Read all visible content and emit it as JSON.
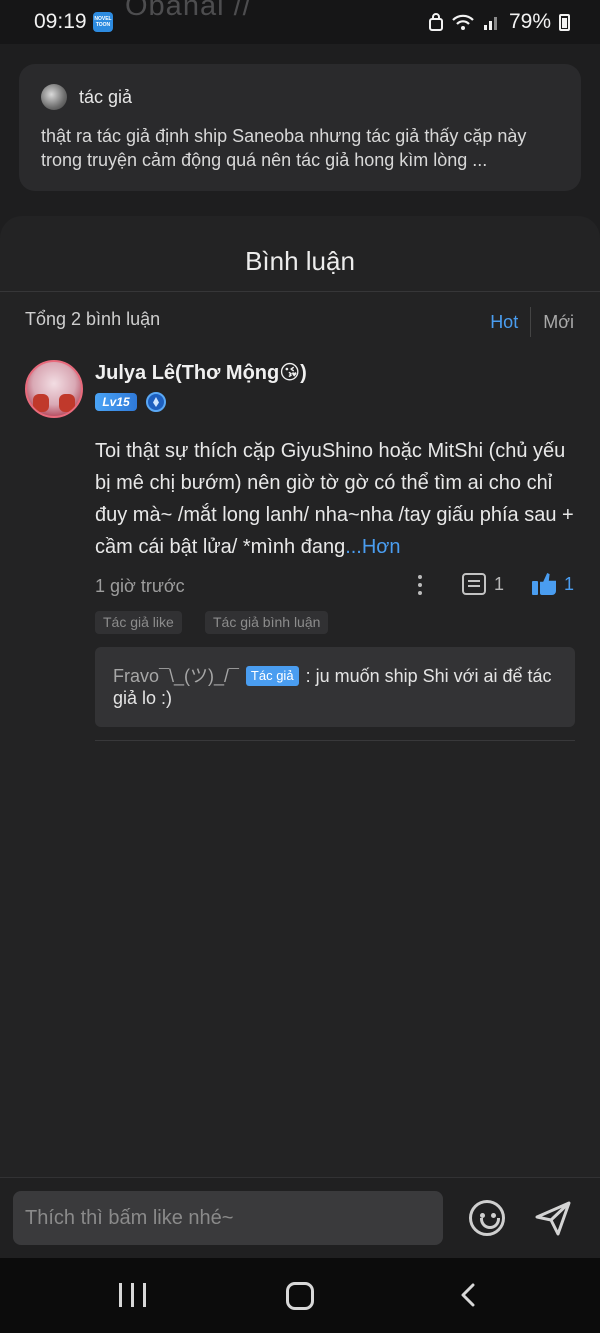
{
  "status_bar": {
    "time": "09:19",
    "app_badge": "NOVEL TOON",
    "background_title": "Obanai //",
    "battery": "79%"
  },
  "author_note": {
    "name": "tác giả",
    "text": "thật ra tác giả định ship Saneoba nhưng tác giả thấy cặp này trong truyện cảm động quá nên tác giả hong kìm lòng ..."
  },
  "comments_sheet": {
    "title": "Bình luận",
    "count_label": "Tổng 2 bình luận",
    "sort_hot": "Hot",
    "sort_new": "Mới"
  },
  "comment": {
    "user_name": "Julya Lê(Thơ Mộng😘)",
    "level": "Lv15",
    "body": "Toi thật sự thích cặp GiyuShino hoặc MitShi (chủ yếu bị mê chị bướm) nên giờ tờ gờ có thể tìm ai cho chỉ đuy mà~ /mắt long lanh/ nha~nha /tay giấu phía sau + cầm cái bật lửa/ *mình đang",
    "more": "...Hơn",
    "time": "1 giờ trước",
    "reply_count": "1",
    "like_count": "1",
    "tags": [
      "Tác giả like",
      "Tác giả bình luận"
    ],
    "reply": {
      "user": "Fravo¯\\_(ツ)_/¯",
      "badge": "Tác giả",
      "text": ": ju muốn ship Shi với ai để tác giả lo :)"
    }
  },
  "composer": {
    "placeholder": "Thích thì bấm like nhé~"
  },
  "colors": {
    "accent": "#4a9df0",
    "background": "#1e1e1f",
    "card": "#2a2a2c"
  }
}
